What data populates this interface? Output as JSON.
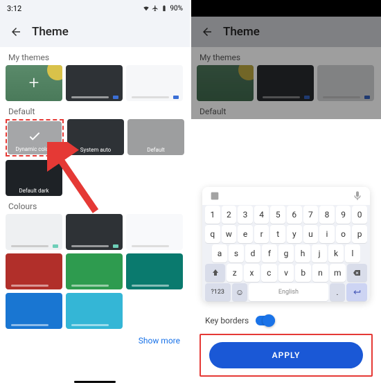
{
  "left": {
    "status": {
      "time": "3:12",
      "battery": "90%"
    },
    "title": "Theme",
    "sections": {
      "my_themes": "My themes",
      "default": "Default",
      "colours": "Colours"
    },
    "default_thumbs": {
      "dynamic": "Dynamic colour",
      "system": "System auto",
      "def": "Default",
      "dark": "Default dark"
    },
    "show_more": "Show more"
  },
  "right": {
    "title": "Theme",
    "sections": {
      "my_themes": "My themes",
      "default": "Default"
    },
    "keyboard": {
      "row1": [
        "1",
        "2",
        "3",
        "4",
        "5",
        "6",
        "7",
        "8",
        "9",
        "0"
      ],
      "row2": [
        "q",
        "w",
        "e",
        "r",
        "t",
        "y",
        "u",
        "i",
        "o",
        "p"
      ],
      "row3": [
        "a",
        "s",
        "d",
        "f",
        "g",
        "h",
        "j",
        "k",
        "l"
      ],
      "row4": [
        "z",
        "x",
        "c",
        "v",
        "b",
        "n",
        "m"
      ],
      "sym": "?123",
      "lang": "English"
    },
    "key_borders": "Key borders",
    "apply": "APPLY"
  }
}
